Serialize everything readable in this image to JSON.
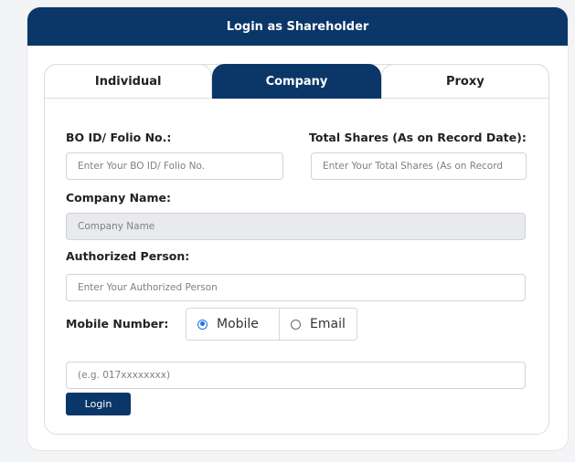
{
  "header": {
    "title": "Login as Shareholder"
  },
  "tabs": [
    {
      "label": "Individual",
      "active": false
    },
    {
      "label": "Company",
      "active": true
    },
    {
      "label": "Proxy",
      "active": false
    }
  ],
  "form": {
    "bo_id": {
      "label": "BO ID/ Folio No.:",
      "placeholder": "Enter Your BO ID/ Folio No."
    },
    "total_shares": {
      "label": "Total Shares (As on Record Date):",
      "placeholder": "Enter Your Total Shares (As on Record"
    },
    "company_name": {
      "label": "Company Name:",
      "placeholder": "Company Name",
      "disabled": true
    },
    "authorized_person": {
      "label": "Authorized Person:",
      "placeholder": "Enter Your Authorized Person"
    },
    "contact": {
      "label": "Mobile Number:",
      "options": [
        {
          "label": "Mobile",
          "selected": true
        },
        {
          "label": "Email",
          "selected": false
        }
      ],
      "placeholder": "(e.g. 017xxxxxxxx)"
    },
    "submit_label": "Login"
  },
  "colors": {
    "primary": "#0b3668",
    "radio_accent": "#1a73e8",
    "disabled_bg": "#e8eaed"
  }
}
